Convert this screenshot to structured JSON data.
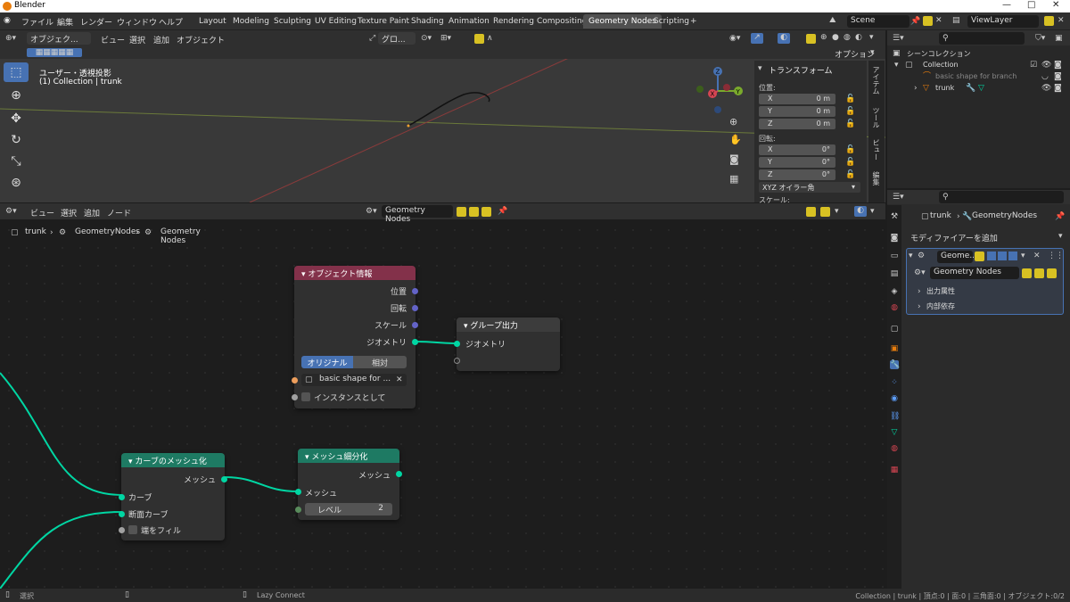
{
  "window": {
    "title": "Blender",
    "minimize": "—",
    "maximize": "□",
    "close": "✕"
  },
  "menu": [
    "ファイル",
    "編集",
    "レンダー",
    "ウィンドウ",
    "ヘルプ"
  ],
  "workspace_tabs": [
    "Layout",
    "Modeling",
    "Sculpting",
    "UV Editing",
    "Texture Paint",
    "Shading",
    "Animation",
    "Rendering",
    "Compositing",
    "Geometry Nodes",
    "Scripting"
  ],
  "active_workspace": "Geometry Nodes",
  "add_tab": "+",
  "scene": {
    "name": "Scene",
    "view_layer": "ViewLayer"
  },
  "viewport": {
    "mode": "オブジェク...",
    "menus": [
      "ビュー",
      "選択",
      "追加",
      "オブジェクト"
    ],
    "orientation": "グロ...",
    "overlay_title": "ユーザー・透視投影",
    "overlay_sub": "(1) Collection | trunk",
    "options_label": "オプション"
  },
  "npanel": {
    "title": "トランスフォーム",
    "location_label": "位置:",
    "location": [
      {
        "axis": "X",
        "value": "0 m"
      },
      {
        "axis": "Y",
        "value": "0 m"
      },
      {
        "axis": "Z",
        "value": "0 m"
      }
    ],
    "rotation_label": "回転:",
    "rotation": [
      {
        "axis": "X",
        "value": "0°"
      },
      {
        "axis": "Y",
        "value": "0°"
      },
      {
        "axis": "Z",
        "value": "0°"
      }
    ],
    "rotation_mode": "XYZ オイラー角",
    "scale_label": "スケール:",
    "tabs": [
      "アイテム",
      "ツール",
      "ビュー",
      "編集"
    ]
  },
  "outliner": {
    "root": "シーンコレクション",
    "collection": "Collection",
    "items": [
      "basic shape for branch",
      "trunk"
    ]
  },
  "properties": {
    "breadcrumb_object": "trunk",
    "breadcrumb_modifier": "GeometryNodes",
    "add_modifier": "モディファイアーを追加",
    "modifier_name": "Geome...",
    "node_group": "Geometry Nodes",
    "sections": [
      "出力属性",
      "内部依存"
    ]
  },
  "node_editor": {
    "menus": [
      "ビュー",
      "選択",
      "追加",
      "ノード"
    ],
    "tree_name": "Geometry Nodes",
    "breadcrumbs": [
      "trunk",
      "GeometryNodes",
      "Geometry Nodes"
    ]
  },
  "nodes": {
    "object_info": {
      "title": "オブジェクト情報",
      "outputs": [
        "位置",
        "回転",
        "スケール",
        "ジオメトリ"
      ],
      "mode_options": [
        "オリジナル",
        "相対"
      ],
      "object": "basic shape for ...",
      "as_instance": "インスタンスとして"
    },
    "group_output": {
      "title": "グループ出力",
      "input": "ジオメトリ"
    },
    "curve_to_mesh": {
      "title": "カーブのメッシュ化",
      "output": "メッシュ",
      "inputs": [
        "カーブ",
        "断面カーブ"
      ],
      "fill_caps": "端をフィル"
    },
    "subdivide": {
      "title": "メッシュ細分化",
      "output": "メッシュ",
      "input": "メッシュ",
      "level_label": "レベル",
      "level": "2"
    }
  },
  "status": {
    "left": "選択",
    "middle": "Lazy Connect",
    "right": "Collection | trunk | 頂点:0 | 面:0 | 三角面:0 | オブジェクト:0/2"
  },
  "colors": {
    "accent_blue": "#4772b3",
    "object_info_header": "#83314a",
    "output_header": "#3c3c3c",
    "geometry_header": "#1e7a63",
    "geometry_socket": "#00d6a3"
  }
}
